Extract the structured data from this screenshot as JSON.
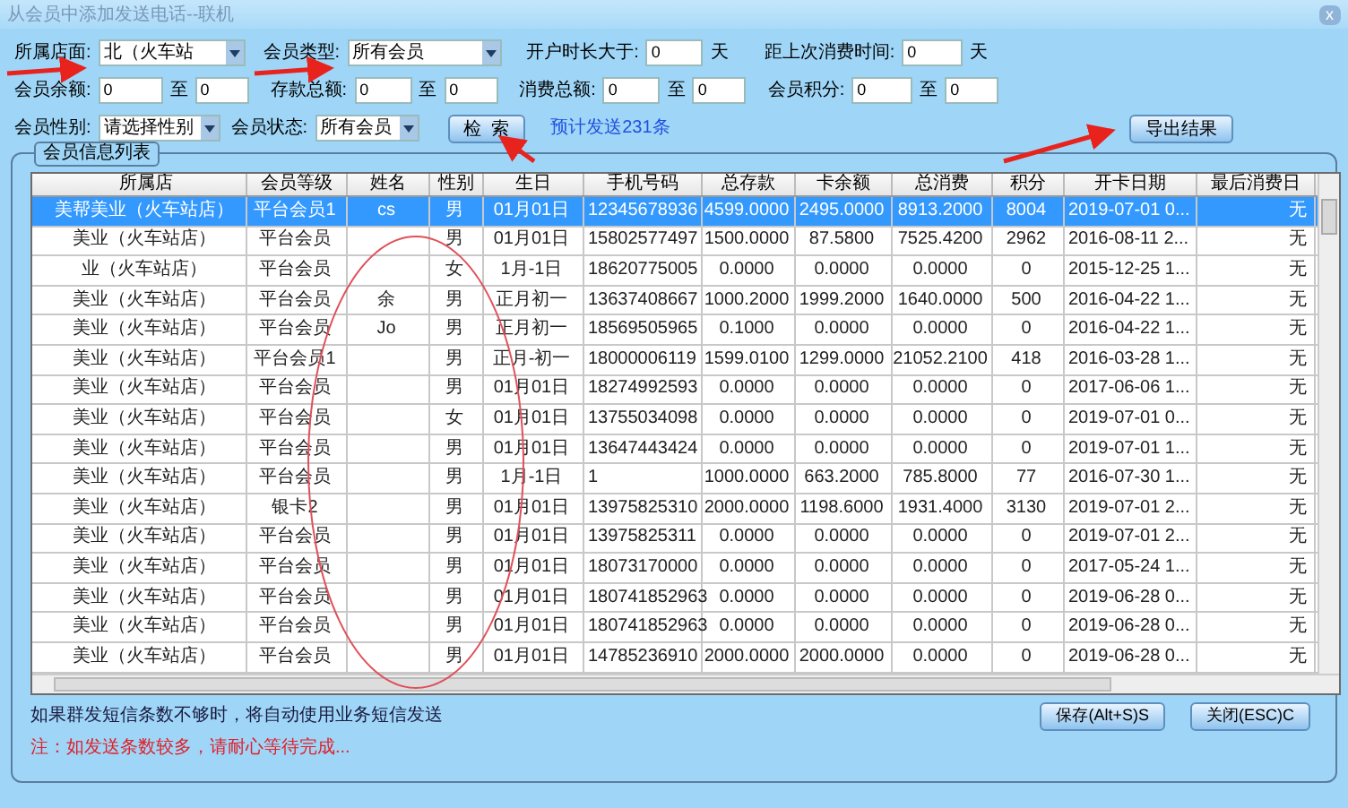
{
  "window": {
    "title": "从会员中添加发送电话--联机",
    "close": "x"
  },
  "filters": [
    [
      {
        "kind": "label",
        "text": "所属店面:"
      },
      {
        "kind": "select",
        "value": "北（火车站"
      },
      {
        "kind": "label",
        "text": "会员类型:"
      },
      {
        "kind": "select",
        "value": "所有会员"
      },
      {
        "kind": "label",
        "text": "开户时长大于:"
      },
      {
        "kind": "input",
        "value": "0"
      },
      {
        "kind": "label",
        "text": "天"
      },
      {
        "kind": "label",
        "text": "距上次消费时间:"
      },
      {
        "kind": "input",
        "value": "0"
      },
      {
        "kind": "label",
        "text": "天"
      }
    ],
    [
      {
        "kind": "label",
        "text": "会员余额:"
      },
      {
        "kind": "input",
        "value": "0"
      },
      {
        "kind": "label",
        "text": "至"
      },
      {
        "kind": "input",
        "value": "0"
      },
      {
        "kind": "label",
        "text": "存款总额:"
      },
      {
        "kind": "input",
        "value": "0"
      },
      {
        "kind": "label",
        "text": "至"
      },
      {
        "kind": "input",
        "value": "0"
      },
      {
        "kind": "label",
        "text": "消费总额:"
      },
      {
        "kind": "input",
        "value": "0"
      },
      {
        "kind": "label",
        "text": "至"
      },
      {
        "kind": "input",
        "value": "0"
      },
      {
        "kind": "label",
        "text": "会员积分:"
      },
      {
        "kind": "input",
        "value": "0"
      },
      {
        "kind": "label",
        "text": "至"
      },
      {
        "kind": "input",
        "value": "0"
      }
    ],
    [
      {
        "kind": "label",
        "text": "会员性别:"
      },
      {
        "kind": "select",
        "value": "请选择性别"
      },
      {
        "kind": "label",
        "text": "会员状态:"
      },
      {
        "kind": "select",
        "value": "所有会员"
      },
      {
        "kind": "button",
        "text": "检  索"
      },
      {
        "kind": "note",
        "text": "预计发送231条"
      },
      {
        "kind": "button",
        "text": "导出结果"
      }
    ]
  ],
  "group": {
    "title": "会员信息列表"
  },
  "table": {
    "columns": [
      "所属店",
      "会员等级",
      "姓名",
      "性别",
      "生日",
      "手机号码",
      "总存款",
      "卡余额",
      "总消费",
      "积分",
      "开卡日期",
      "最后消费日"
    ],
    "rows": [
      {
        "selected": true,
        "cells": [
          "美帮美业（火车站店）",
          "平台会员1",
          "cs",
          "男",
          "01月01日",
          "12345678936",
          "4599.0000",
          "2495.0000",
          "8913.2000",
          "8004",
          "2019-07-01 0...",
          "无"
        ]
      },
      {
        "selected": false,
        "cells": [
          "美业（火车站店）",
          "平台会员",
          "",
          "男",
          "01月01日",
          "15802577497",
          "1500.0000",
          "87.5800",
          "7525.4200",
          "2962",
          "2016-08-11 2...",
          "无"
        ]
      },
      {
        "selected": false,
        "cells": [
          "业（火车站店）",
          "平台会员",
          "",
          "女",
          "1月-1日",
          "18620775005",
          "0.0000",
          "0.0000",
          "0.0000",
          "0",
          "2015-12-25 1...",
          "无"
        ]
      },
      {
        "selected": false,
        "cells": [
          "美业（火车站店）",
          "平台会员",
          "余",
          "男",
          "正月初一",
          "13637408667",
          "1000.2000",
          "1999.2000",
          "1640.0000",
          "500",
          "2016-04-22 1...",
          "无"
        ]
      },
      {
        "selected": false,
        "cells": [
          "美业（火车站店）",
          "平台会员",
          "Jo",
          "男",
          "正月初一",
          "18569505965",
          "0.1000",
          "0.0000",
          "0.0000",
          "0",
          "2016-04-22 1...",
          "无"
        ]
      },
      {
        "selected": false,
        "cells": [
          "美业（火车站店）",
          "平台会员1",
          "",
          "男",
          "正月-初一",
          "18000006119",
          "1599.0100",
          "1299.0000",
          "21052.2100",
          "418",
          "2016-03-28 1...",
          "无"
        ]
      },
      {
        "selected": false,
        "cells": [
          "美业（火车站店）",
          "平台会员",
          "",
          "男",
          "01月01日",
          "18274992593",
          "0.0000",
          "0.0000",
          "0.0000",
          "0",
          "2017-06-06 1...",
          "无"
        ]
      },
      {
        "selected": false,
        "cells": [
          "美业（火车站店）",
          "平台会员",
          "",
          "女",
          "01月01日",
          "13755034098",
          "0.0000",
          "0.0000",
          "0.0000",
          "0",
          "2019-07-01 0...",
          "无"
        ]
      },
      {
        "selected": false,
        "cells": [
          "美业（火车站店）",
          "平台会员",
          "",
          "男",
          "01月01日",
          "13647443424",
          "0.0000",
          "0.0000",
          "0.0000",
          "0",
          "2019-07-01 1...",
          "无"
        ]
      },
      {
        "selected": false,
        "cells": [
          "美业（火车站店）",
          "平台会员",
          "",
          "男",
          "1月-1日",
          "1",
          "1000.0000",
          "663.2000",
          "785.8000",
          "77",
          "2016-07-30 1...",
          "无"
        ]
      },
      {
        "selected": false,
        "cells": [
          "美业（火车站店）",
          "银卡2",
          "",
          "男",
          "01月01日",
          "13975825310",
          "2000.0000",
          "1198.6000",
          "1931.4000",
          "3130",
          "2019-07-01 2...",
          "无"
        ]
      },
      {
        "selected": false,
        "cells": [
          "美业（火车站店）",
          "平台会员",
          "",
          "男",
          "01月01日",
          "13975825311",
          "0.0000",
          "0.0000",
          "0.0000",
          "0",
          "2019-07-01 2...",
          "无"
        ]
      },
      {
        "selected": false,
        "cells": [
          "美业（火车站店）",
          "平台会员",
          "",
          "男",
          "01月01日",
          "18073170000",
          "0.0000",
          "0.0000",
          "0.0000",
          "0",
          "2017-05-24 1...",
          "无"
        ]
      },
      {
        "selected": false,
        "cells": [
          "美业（火车站店）",
          "平台会员",
          "",
          "男",
          "01月01日",
          "180741852963",
          "0.0000",
          "0.0000",
          "0.0000",
          "0",
          "2019-06-28 0...",
          "无"
        ]
      },
      {
        "selected": false,
        "cells": [
          "美业（火车站店）",
          "平台会员",
          "",
          "男",
          "01月01日",
          "180741852963",
          "0.0000",
          "0.0000",
          "0.0000",
          "0",
          "2019-06-28 0...",
          "无"
        ]
      },
      {
        "selected": false,
        "cells": [
          "美业（火车站店）",
          "平台会员",
          "",
          "男",
          "01月01日",
          "14785236910",
          "2000.0000",
          "2000.0000",
          "0.0000",
          "0",
          "2019-06-28 0...",
          "无"
        ]
      }
    ]
  },
  "footer": {
    "info": "如果群发短信条数不够时，将自动使用业务短信发送",
    "warning": "注：如发送条数较多，请耐心等待完成...",
    "buttons": [
      "保存(Alt+S)S",
      "关闭(ESC)C"
    ]
  }
}
